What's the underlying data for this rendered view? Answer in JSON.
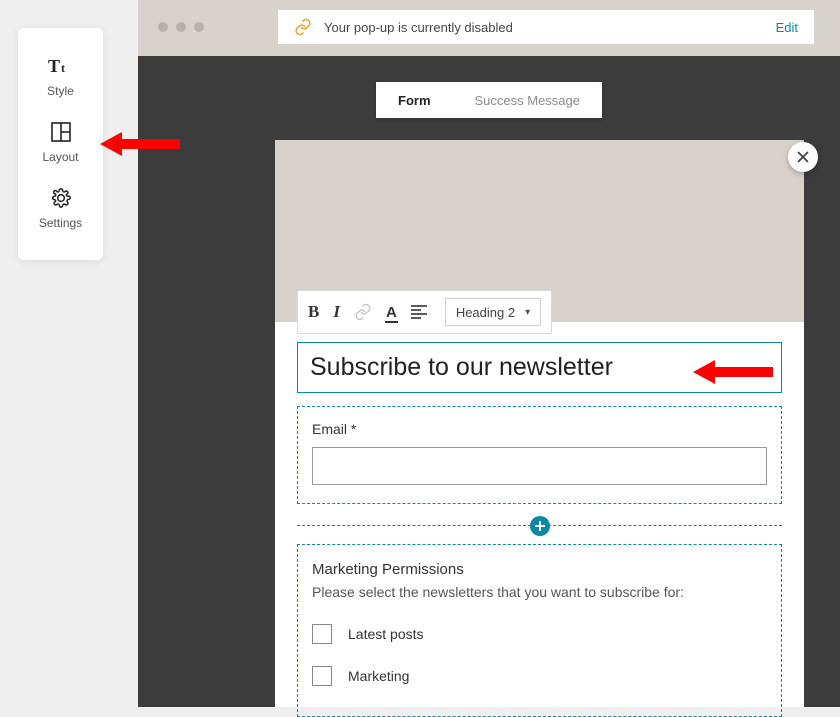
{
  "sidebar": {
    "items": [
      {
        "label": "Style"
      },
      {
        "label": "Layout"
      },
      {
        "label": "Settings"
      }
    ]
  },
  "topbar": {
    "status_text": "Your pop-up is currently disabled",
    "edit_label": "Edit"
  },
  "tabs": {
    "form": "Form",
    "success": "Success Message"
  },
  "toolbar": {
    "heading_select": "Heading 2"
  },
  "popup": {
    "heading": "Subscribe to our newsletter",
    "email_label": "Email *",
    "perm_title": "Marketing Permissions",
    "perm_desc": "Please select the newsletters that you want to subscribe for:",
    "options": [
      "Latest posts",
      "Marketing"
    ]
  }
}
